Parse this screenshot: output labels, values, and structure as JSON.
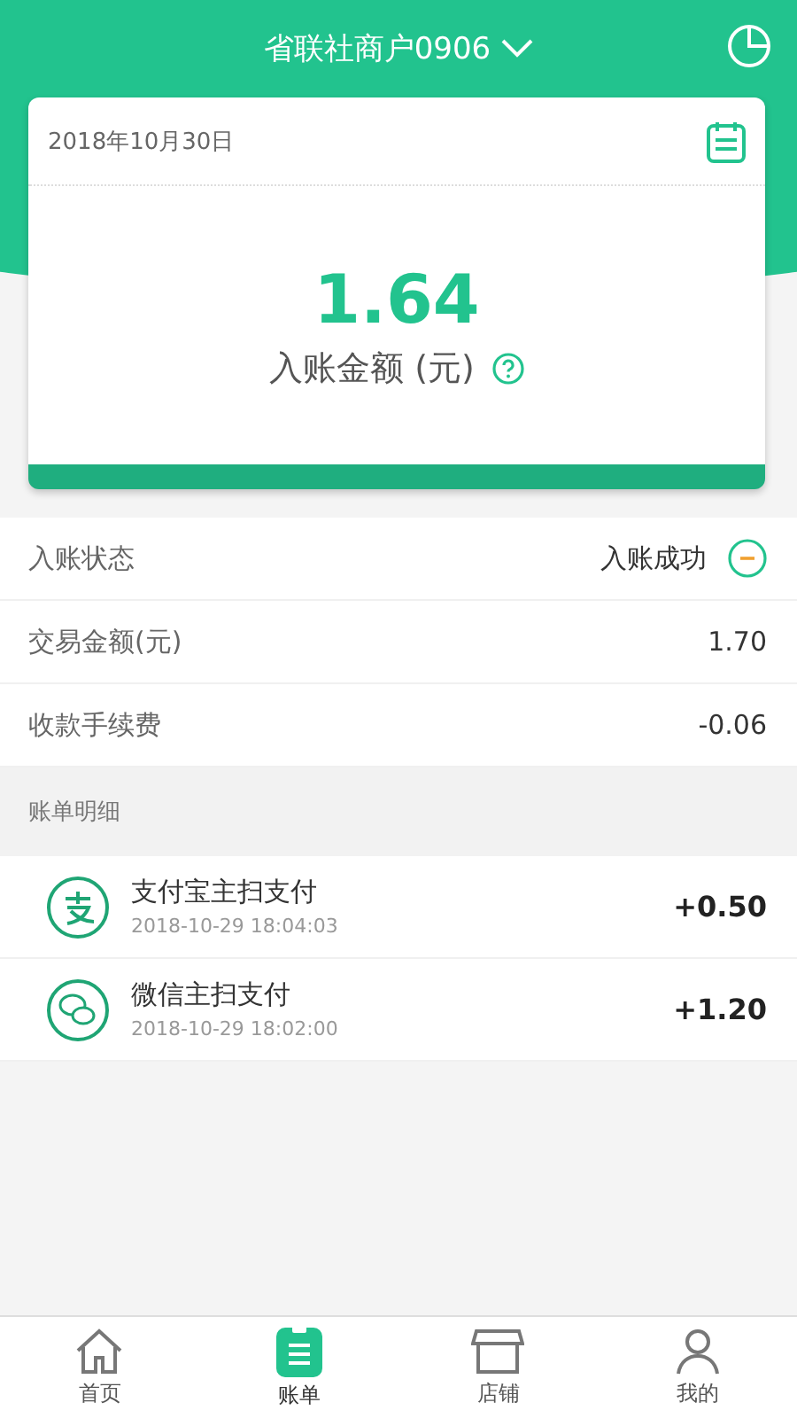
{
  "header": {
    "title": "省联社商户0906"
  },
  "summary": {
    "date": "2018年10月30日",
    "amount": "1.64",
    "amount_label": "入账金额 (元)"
  },
  "details": [
    {
      "kind": "status",
      "label": "入账状态",
      "value": "入账成功"
    },
    {
      "kind": "plain",
      "label": "交易金额(元)",
      "value": "1.70"
    },
    {
      "kind": "plain",
      "label": "收款手续费",
      "value": "-0.06"
    }
  ],
  "section_title": "账单明细",
  "transactions": [
    {
      "kind": "alipay",
      "title": "支付宝主扫支付",
      "time": "2018-10-29 18:04:03",
      "amount": "+0.50"
    },
    {
      "kind": "wechat",
      "title": "微信主扫支付",
      "time": "2018-10-29 18:02:00",
      "amount": "+1.20"
    }
  ],
  "tabs": [
    {
      "kind": "home",
      "label": "首页",
      "selected": false
    },
    {
      "kind": "bill",
      "label": "账单",
      "selected": true
    },
    {
      "kind": "store",
      "label": "店铺",
      "selected": false
    },
    {
      "kind": "user",
      "label": "我的",
      "selected": false
    }
  ]
}
